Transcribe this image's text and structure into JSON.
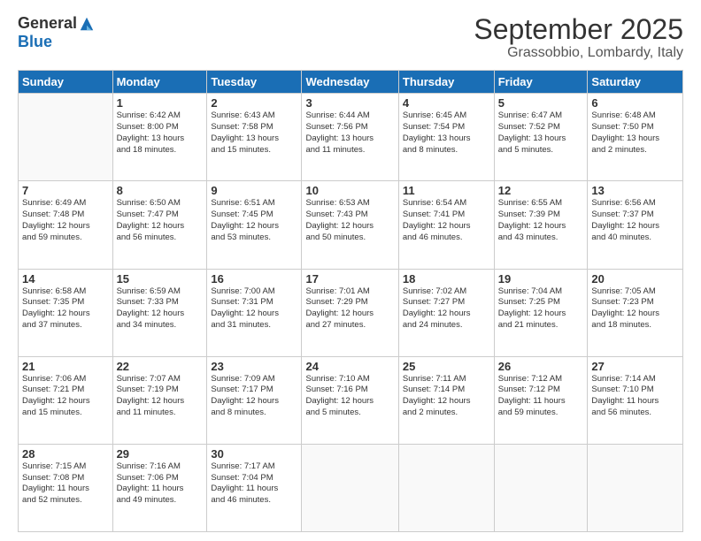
{
  "logo": {
    "general": "General",
    "blue": "Blue"
  },
  "title": "September 2025",
  "subtitle": "Grassobbio, Lombardy, Italy",
  "days_of_week": [
    "Sunday",
    "Monday",
    "Tuesday",
    "Wednesday",
    "Thursday",
    "Friday",
    "Saturday"
  ],
  "weeks": [
    [
      {
        "day": "",
        "info": ""
      },
      {
        "day": "1",
        "info": "Sunrise: 6:42 AM\nSunset: 8:00 PM\nDaylight: 13 hours\nand 18 minutes."
      },
      {
        "day": "2",
        "info": "Sunrise: 6:43 AM\nSunset: 7:58 PM\nDaylight: 13 hours\nand 15 minutes."
      },
      {
        "day": "3",
        "info": "Sunrise: 6:44 AM\nSunset: 7:56 PM\nDaylight: 13 hours\nand 11 minutes."
      },
      {
        "day": "4",
        "info": "Sunrise: 6:45 AM\nSunset: 7:54 PM\nDaylight: 13 hours\nand 8 minutes."
      },
      {
        "day": "5",
        "info": "Sunrise: 6:47 AM\nSunset: 7:52 PM\nDaylight: 13 hours\nand 5 minutes."
      },
      {
        "day": "6",
        "info": "Sunrise: 6:48 AM\nSunset: 7:50 PM\nDaylight: 13 hours\nand 2 minutes."
      }
    ],
    [
      {
        "day": "7",
        "info": "Sunrise: 6:49 AM\nSunset: 7:48 PM\nDaylight: 12 hours\nand 59 minutes."
      },
      {
        "day": "8",
        "info": "Sunrise: 6:50 AM\nSunset: 7:47 PM\nDaylight: 12 hours\nand 56 minutes."
      },
      {
        "day": "9",
        "info": "Sunrise: 6:51 AM\nSunset: 7:45 PM\nDaylight: 12 hours\nand 53 minutes."
      },
      {
        "day": "10",
        "info": "Sunrise: 6:53 AM\nSunset: 7:43 PM\nDaylight: 12 hours\nand 50 minutes."
      },
      {
        "day": "11",
        "info": "Sunrise: 6:54 AM\nSunset: 7:41 PM\nDaylight: 12 hours\nand 46 minutes."
      },
      {
        "day": "12",
        "info": "Sunrise: 6:55 AM\nSunset: 7:39 PM\nDaylight: 12 hours\nand 43 minutes."
      },
      {
        "day": "13",
        "info": "Sunrise: 6:56 AM\nSunset: 7:37 PM\nDaylight: 12 hours\nand 40 minutes."
      }
    ],
    [
      {
        "day": "14",
        "info": "Sunrise: 6:58 AM\nSunset: 7:35 PM\nDaylight: 12 hours\nand 37 minutes."
      },
      {
        "day": "15",
        "info": "Sunrise: 6:59 AM\nSunset: 7:33 PM\nDaylight: 12 hours\nand 34 minutes."
      },
      {
        "day": "16",
        "info": "Sunrise: 7:00 AM\nSunset: 7:31 PM\nDaylight: 12 hours\nand 31 minutes."
      },
      {
        "day": "17",
        "info": "Sunrise: 7:01 AM\nSunset: 7:29 PM\nDaylight: 12 hours\nand 27 minutes."
      },
      {
        "day": "18",
        "info": "Sunrise: 7:02 AM\nSunset: 7:27 PM\nDaylight: 12 hours\nand 24 minutes."
      },
      {
        "day": "19",
        "info": "Sunrise: 7:04 AM\nSunset: 7:25 PM\nDaylight: 12 hours\nand 21 minutes."
      },
      {
        "day": "20",
        "info": "Sunrise: 7:05 AM\nSunset: 7:23 PM\nDaylight: 12 hours\nand 18 minutes."
      }
    ],
    [
      {
        "day": "21",
        "info": "Sunrise: 7:06 AM\nSunset: 7:21 PM\nDaylight: 12 hours\nand 15 minutes."
      },
      {
        "day": "22",
        "info": "Sunrise: 7:07 AM\nSunset: 7:19 PM\nDaylight: 12 hours\nand 11 minutes."
      },
      {
        "day": "23",
        "info": "Sunrise: 7:09 AM\nSunset: 7:17 PM\nDaylight: 12 hours\nand 8 minutes."
      },
      {
        "day": "24",
        "info": "Sunrise: 7:10 AM\nSunset: 7:16 PM\nDaylight: 12 hours\nand 5 minutes."
      },
      {
        "day": "25",
        "info": "Sunrise: 7:11 AM\nSunset: 7:14 PM\nDaylight: 12 hours\nand 2 minutes."
      },
      {
        "day": "26",
        "info": "Sunrise: 7:12 AM\nSunset: 7:12 PM\nDaylight: 11 hours\nand 59 minutes."
      },
      {
        "day": "27",
        "info": "Sunrise: 7:14 AM\nSunset: 7:10 PM\nDaylight: 11 hours\nand 56 minutes."
      }
    ],
    [
      {
        "day": "28",
        "info": "Sunrise: 7:15 AM\nSunset: 7:08 PM\nDaylight: 11 hours\nand 52 minutes."
      },
      {
        "day": "29",
        "info": "Sunrise: 7:16 AM\nSunset: 7:06 PM\nDaylight: 11 hours\nand 49 minutes."
      },
      {
        "day": "30",
        "info": "Sunrise: 7:17 AM\nSunset: 7:04 PM\nDaylight: 11 hours\nand 46 minutes."
      },
      {
        "day": "",
        "info": ""
      },
      {
        "day": "",
        "info": ""
      },
      {
        "day": "",
        "info": ""
      },
      {
        "day": "",
        "info": ""
      }
    ]
  ]
}
